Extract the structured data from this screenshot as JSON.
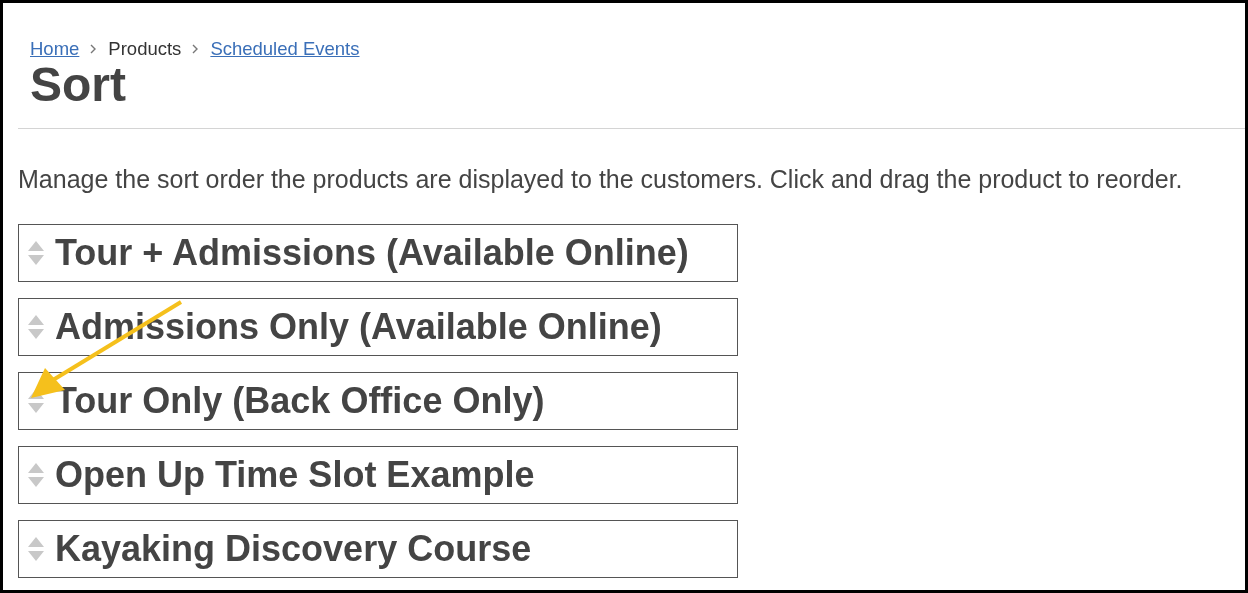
{
  "breadcrumb": [
    {
      "label": "Home",
      "kind": "link"
    },
    {
      "label": "Products",
      "kind": "text"
    },
    {
      "label": "Scheduled Events",
      "kind": "link"
    }
  ],
  "title": "Sort",
  "description": "Manage the sort order the products are displayed to the customers. Click and drag the product to reorder.",
  "products": [
    {
      "name": "Tour + Admissions (Available Online)"
    },
    {
      "name": "Admissions Only (Available Online)"
    },
    {
      "name": "Tour Only (Back Office Only)"
    },
    {
      "name": "Open Up Time Slot Example"
    },
    {
      "name": "Kayaking Discovery Course"
    }
  ]
}
